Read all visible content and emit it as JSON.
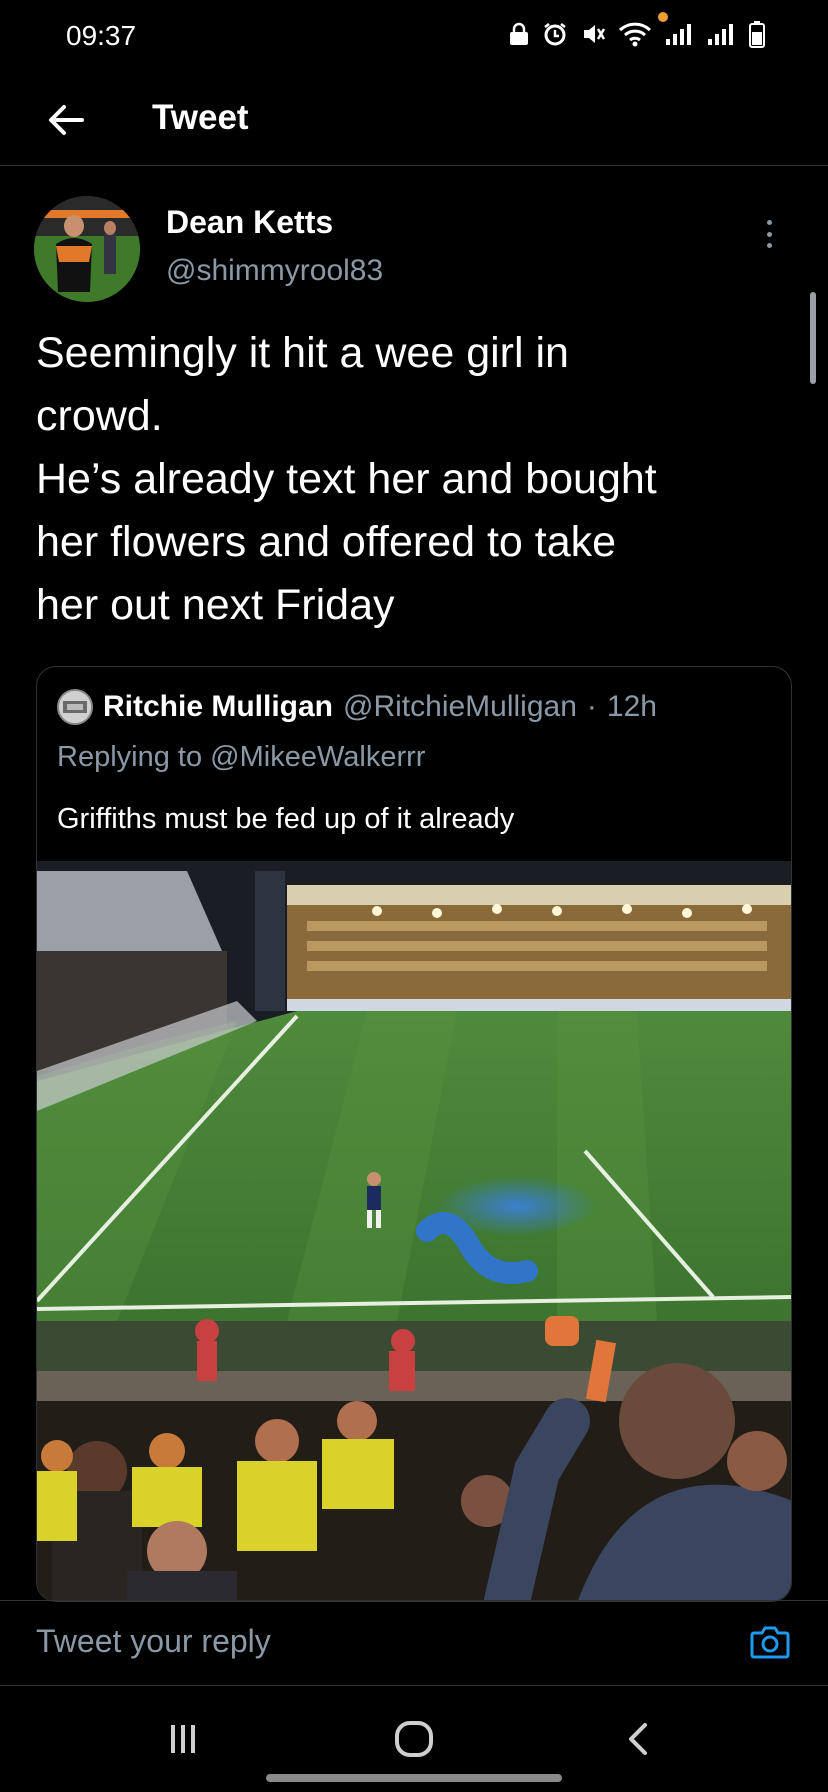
{
  "status": {
    "time": "09:37"
  },
  "header": {
    "title": "Tweet"
  },
  "tweet": {
    "author_name": "Dean Ketts",
    "author_handle": "@shimmyrool83",
    "text": "Seemingly it hit a wee girl in\ncrowd.\nHe’s already text her and bought\nher flowers and offered to take\nher out next Friday"
  },
  "quote": {
    "author_name": "Ritchie Mulligan",
    "author_handle": "@RitchieMulligan",
    "separator": "·",
    "time": "12h",
    "replying_label": "Replying to",
    "replying_to": "@MikeeWalkerrr",
    "text": "Griffiths must be fed up of it already"
  },
  "reply_bar": {
    "placeholder": "Tweet your reply"
  },
  "colors": {
    "background": "#000000",
    "text": "#ffffff",
    "secondary": "#8b98a5",
    "accent": "#1d9bf0",
    "border": "#2f3336"
  },
  "icons": {
    "back": "arrow-left-icon",
    "more": "more-vertical-icon",
    "camera": "camera-icon",
    "nav_recents": "recents-icon",
    "nav_home": "home-icon",
    "nav_back": "chevron-left-icon"
  }
}
